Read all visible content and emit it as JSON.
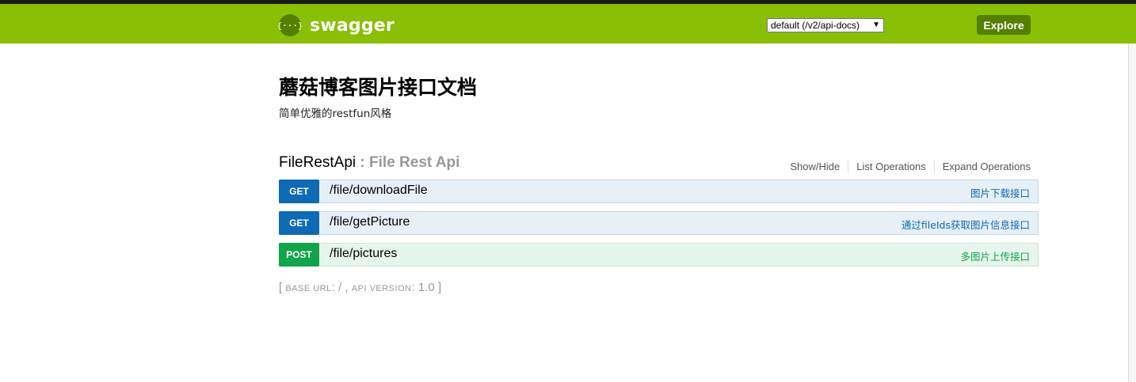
{
  "header": {
    "logo_glyph": "{···}",
    "brand": "swagger",
    "spec_select": "default (/v2/api-docs)",
    "spec_arrow": "▼",
    "explore": "Explore",
    "bg_color": "#89bf04",
    "button_color": "#547f00"
  },
  "info": {
    "title": "蘑菇博客图片接口文档",
    "description": "简单优雅的restfun风格"
  },
  "resource": {
    "name": "FileRestApi",
    "separator": " : ",
    "description": "File Rest Api",
    "links": [
      "Show/Hide",
      "List Operations",
      "Expand Operations"
    ]
  },
  "operations": [
    {
      "method": "GET",
      "path": "/file/downloadFile",
      "summary": "图片下载接口",
      "color": "#0f6ab4"
    },
    {
      "method": "GET",
      "path": "/file/getPicture",
      "summary": "通过fileIds获取图片信息接口",
      "color": "#0f6ab4"
    },
    {
      "method": "POST",
      "path": "/file/pictures",
      "summary": "多图片上传接口",
      "color": "#10a54a"
    }
  ],
  "footer": {
    "open_bracket": "[ ",
    "base_url_label": "BASE URL",
    "base_url_value": ": / , ",
    "api_version_label": "API VERSION",
    "api_version_value": ": 1.0 ",
    "close_bracket": "]"
  }
}
